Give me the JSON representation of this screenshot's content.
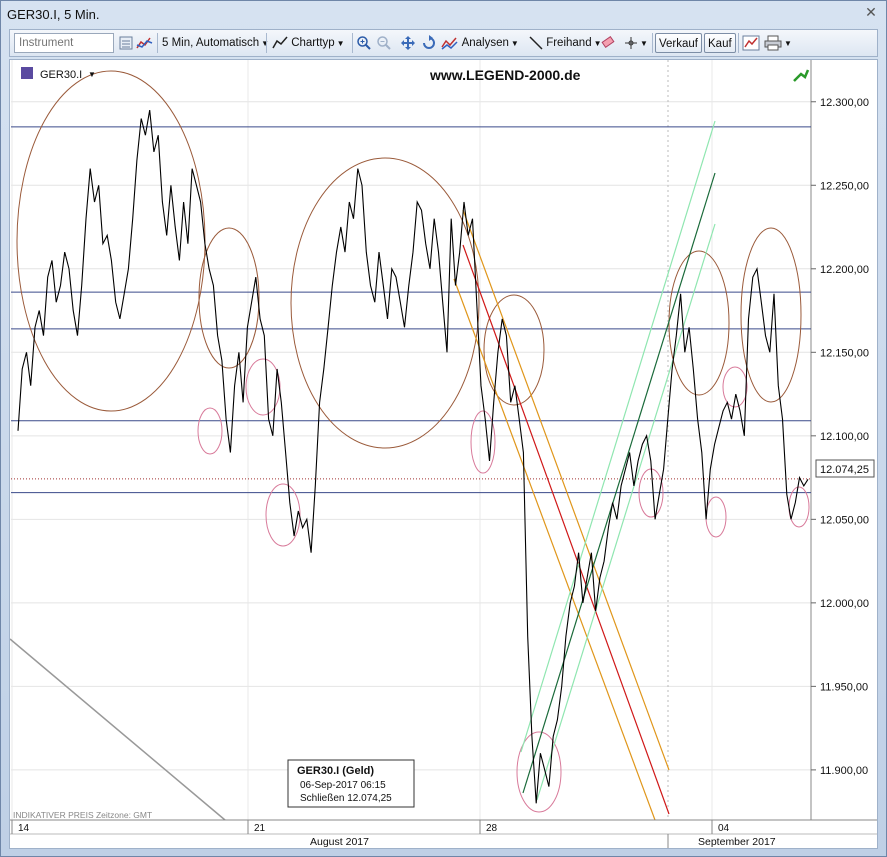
{
  "window": {
    "title": "GER30.I, 5 Min."
  },
  "toolbar": {
    "instrument_placeholder": "Instrument",
    "interval_label": "5 Min, Automatisch",
    "charttype_label": "Charttyp",
    "analysen_label": "Analysen",
    "freihand_label": "Freihand",
    "verkauf_label": "Verkauf",
    "kauf_label": "Kauf"
  },
  "chart": {
    "symbol_label": "GER30.I",
    "watermark": "www.LEGEND-2000.de",
    "current_price_label": "12.074,25",
    "footer_note": "INDIKATIVER PREIS   Zeitzone: GMT",
    "tooltip": {
      "title": "GER30.I (Geld)",
      "date": "06-Sep-2017 06:15",
      "close": "Schließen    12.074,25"
    },
    "colors": {
      "price_line": "#000000",
      "hline": "#3a4a8a",
      "ellipse": "#9a5a3a",
      "red_channel": "#d01818",
      "orange_channel": "#e0961a",
      "green_dark": "#1a6a3a",
      "green_light": "#8fe6b0"
    }
  },
  "chart_data": {
    "type": "line",
    "title": "GER30.I, 5 Min.",
    "xlabel": "",
    "ylabel": "",
    "ylim": [
      11870,
      12325
    ],
    "y_ticks": [
      "12.300,00",
      "12.250,00",
      "12.200,00",
      "12.150,00",
      "12.100,00",
      "12.050,00",
      "12.000,00",
      "11.950,00",
      "11.900,00"
    ],
    "y_tick_values": [
      12300,
      12250,
      12200,
      12150,
      12100,
      12050,
      12000,
      11950,
      11900
    ],
    "x_ticks": [
      "14",
      "21",
      "28",
      "04"
    ],
    "x_periods": [
      "August 2017",
      "September 2017"
    ],
    "horizontal_levels": [
      12285,
      12186,
      12164,
      12109,
      12066
    ],
    "current_price": 12074.25,
    "series": [
      {
        "values": [
          12103,
          12140,
          12150,
          12130,
          12165,
          12175,
          12160,
          12195,
          12205,
          12180,
          12190,
          12210,
          12200,
          12175,
          12160,
          12190,
          12230,
          12260,
          12240,
          12250,
          12215,
          12220,
          12205,
          12180,
          12170,
          12185,
          12200,
          12230,
          12265,
          12290,
          12280,
          12295,
          12270,
          12280,
          12240,
          12220,
          12250,
          12225,
          12205,
          12240,
          12215,
          12260,
          12250,
          12240,
          12215,
          12200,
          12190,
          12160,
          12145,
          12110,
          12090,
          12130,
          12150,
          12120,
          12165,
          12180,
          12195,
          12170,
          12160,
          12110,
          12100,
          12140,
          12120,
          12090,
          12060,
          12040,
          12055,
          12045,
          12050,
          12030,
          12070,
          12120,
          12140,
          12165,
          12190,
          12210,
          12225,
          12210,
          12240,
          12230,
          12260,
          12250,
          12210,
          12190,
          12180,
          12210,
          12190,
          12170,
          12200,
          12195,
          12180,
          12165,
          12190,
          12210,
          12240,
          12235,
          12215,
          12200,
          12230,
          12210,
          12180,
          12150,
          12230,
          12190,
          12210,
          12240,
          12220,
          12230,
          12180,
          12130,
          12110,
          12085,
          12120,
          12150,
          12170,
          12160,
          12120,
          12130,
          12110,
          12090,
          11980,
          11920,
          11880,
          11910,
          11900,
          11890,
          11920,
          11930,
          11950,
          11980,
          12000,
          12010,
          12030,
          12000,
          12015,
          12030,
          11995,
          12015,
          12025,
          12045,
          12060,
          12050,
          12070,
          12080,
          12090,
          12070,
          12085,
          12095,
          12100,
          12085,
          12050,
          12065,
          12080,
          12110,
          12140,
          12160,
          12185,
          12150,
          12165,
          12140,
          12110,
          12090,
          12050,
          12080,
          12095,
          12105,
          12115,
          12120,
          12110,
          12125,
          12115,
          12100,
          12170,
          12195,
          12200,
          12180,
          12160,
          12150,
          12185,
          12130,
          12110,
          12065,
          12050,
          12060,
          12075,
          12070,
          12074
        ]
      }
    ]
  }
}
